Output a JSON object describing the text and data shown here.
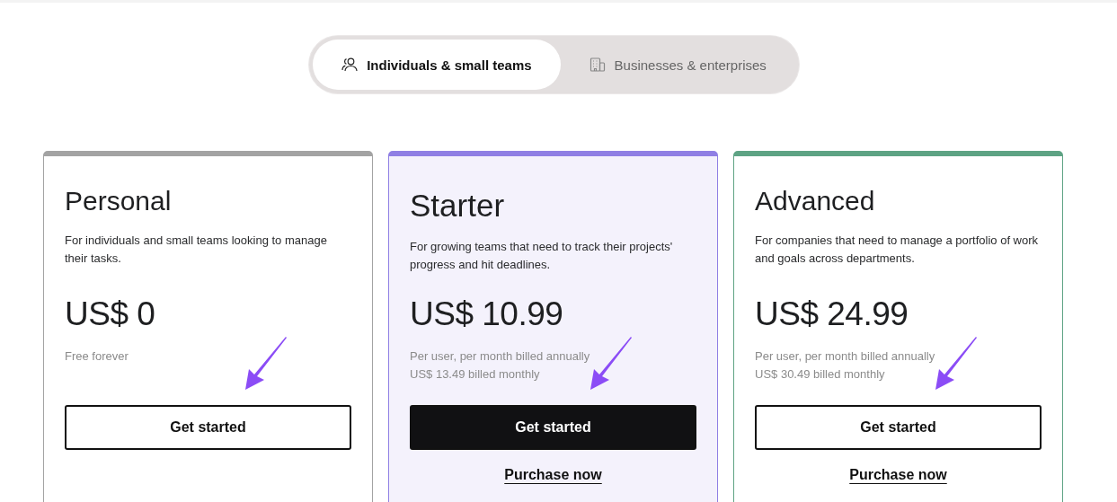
{
  "audience_tabs": [
    {
      "label": "Individuals & small teams",
      "selected": true
    },
    {
      "label": "Businesses & enterprises",
      "selected": false
    }
  ],
  "plans": [
    {
      "name": "Personal",
      "color": "#a3a3a3",
      "featured": false,
      "description": "For individuals and small teams looking to manage their tasks.",
      "price": "US$ 0",
      "notes": [
        "Free forever"
      ],
      "button": {
        "label": "Get started",
        "filled": false
      }
    },
    {
      "name": "Starter",
      "color": "#8f7fe4",
      "featured": true,
      "description": "For growing teams that need to track their projects' progress and hit deadlines.",
      "price": "US$ 10.99",
      "notes": [
        "Per user, per month billed annually",
        "US$ 13.49 billed monthly"
      ],
      "button": {
        "label": "Get started",
        "filled": true
      },
      "link": "Purchase now"
    },
    {
      "name": "Advanced",
      "color": "#5ea384",
      "featured": false,
      "description": "For companies that need to manage a portfolio of work and goals across departments.",
      "price": "US$ 24.99",
      "notes": [
        "Per user, per month billed annually",
        "US$ 30.49 billed monthly"
      ],
      "button": {
        "label": "Get started",
        "filled": false
      },
      "link": "Purchase now"
    }
  ]
}
